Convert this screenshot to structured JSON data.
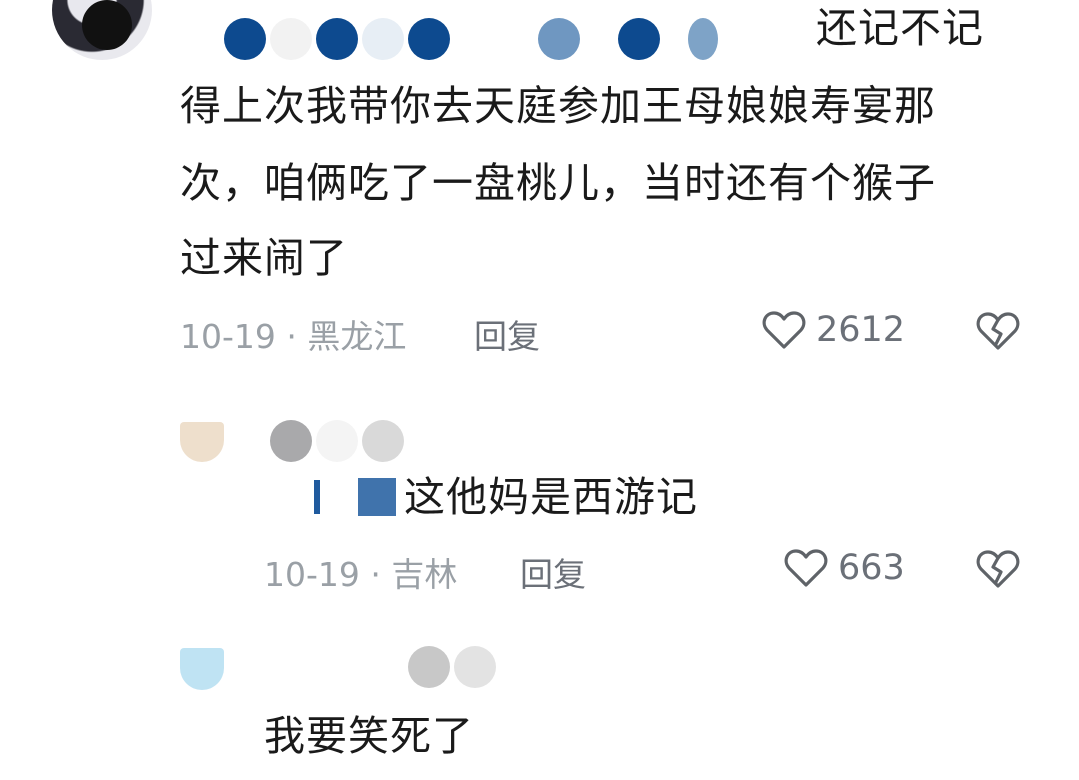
{
  "comments": [
    {
      "text_line1": "还记不记",
      "text_rest": [
        "得上次我带你去天庭参加王母娘娘寿宴那",
        "次，咱俩吃了一盘桃儿，当时还有个猴子",
        "过来闹了"
      ],
      "date": "10-19",
      "separator": "·",
      "location": "黑龙江",
      "reply_label": "回复",
      "likes": "2612"
    },
    {
      "text": "这他妈是西游记",
      "date": "10-19",
      "separator": "·",
      "location": "吉林",
      "reply_label": "回复",
      "likes": "663"
    },
    {
      "text": "我要笑死了"
    }
  ],
  "colors": {
    "username_blue": "#1f5a9e",
    "meta_gray": "#9aa0a6",
    "icon_gray": "#5f6368"
  },
  "icons": {
    "like": "heart-outline-icon",
    "dislike": "broken-heart-icon"
  }
}
